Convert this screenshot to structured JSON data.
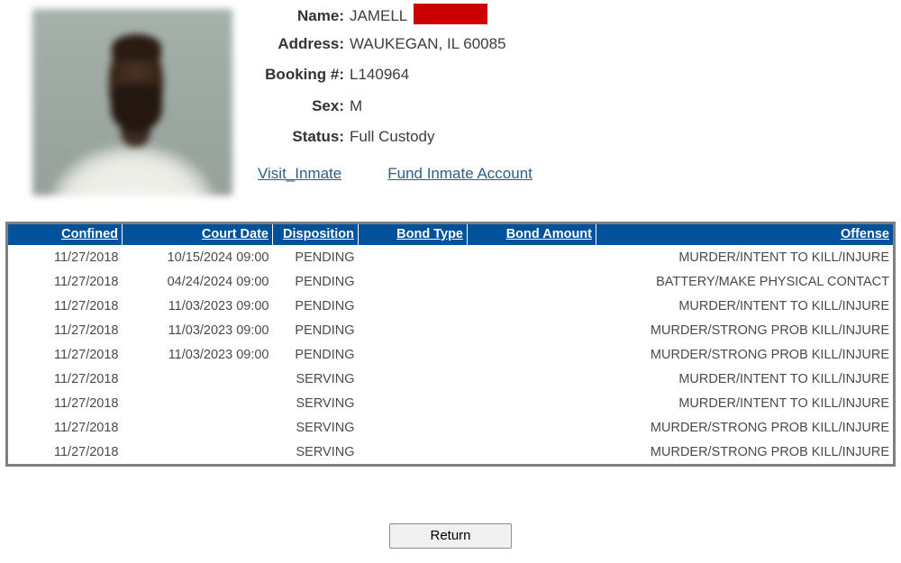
{
  "inmate": {
    "photo_alt": "inmate-mugshot",
    "fields": [
      {
        "label": "Name:",
        "value": "JAMELL",
        "redacted": true
      },
      {
        "label": "Address:",
        "value": "WAUKEGAN, IL 60085",
        "redacted": false
      },
      {
        "label": "Booking #:",
        "value": "L140964",
        "redacted": false
      },
      {
        "label": "Sex:",
        "value": "M",
        "redacted": false
      },
      {
        "label": "Status:",
        "value": "Full Custody",
        "redacted": false
      }
    ],
    "links": [
      {
        "label": "Visit_Inmate"
      },
      {
        "label": "Fund Inmate Account"
      }
    ]
  },
  "charges_table": {
    "columns": [
      "Confined",
      "Court Date",
      "Disposition",
      "Bond Type",
      "Bond Amount",
      "Offense"
    ],
    "rows": [
      {
        "confined": "11/27/2018",
        "court_date": "10/15/2024 09:00",
        "disposition": "PENDING",
        "bond_type": "",
        "bond_amount": "",
        "offense": "MURDER/INTENT TO KILL/INJURE"
      },
      {
        "confined": "11/27/2018",
        "court_date": "04/24/2024 09:00",
        "disposition": "PENDING",
        "bond_type": "",
        "bond_amount": "",
        "offense": "BATTERY/MAKE PHYSICAL CONTACT"
      },
      {
        "confined": "11/27/2018",
        "court_date": "11/03/2023 09:00",
        "disposition": "PENDING",
        "bond_type": "",
        "bond_amount": "",
        "offense": "MURDER/INTENT TO KILL/INJURE"
      },
      {
        "confined": "11/27/2018",
        "court_date": "11/03/2023 09:00",
        "disposition": "PENDING",
        "bond_type": "",
        "bond_amount": "",
        "offense": "MURDER/STRONG PROB KILL/INJURE"
      },
      {
        "confined": "11/27/2018",
        "court_date": "11/03/2023 09:00",
        "disposition": "PENDING",
        "bond_type": "",
        "bond_amount": "",
        "offense": "MURDER/STRONG PROB KILL/INJURE"
      },
      {
        "confined": "11/27/2018",
        "court_date": "",
        "disposition": "SERVING",
        "bond_type": "",
        "bond_amount": "",
        "offense": "MURDER/INTENT TO KILL/INJURE"
      },
      {
        "confined": "11/27/2018",
        "court_date": "",
        "disposition": "SERVING",
        "bond_type": "",
        "bond_amount": "",
        "offense": "MURDER/INTENT TO KILL/INJURE"
      },
      {
        "confined": "11/27/2018",
        "court_date": "",
        "disposition": "SERVING",
        "bond_type": "",
        "bond_amount": "",
        "offense": "MURDER/STRONG PROB KILL/INJURE"
      },
      {
        "confined": "11/27/2018",
        "court_date": "",
        "disposition": "SERVING",
        "bond_type": "",
        "bond_amount": "",
        "offense": "MURDER/STRONG PROB KILL/INJURE"
      }
    ]
  },
  "footer": {
    "return_label": "Return"
  },
  "colors": {
    "header_blue": "#01529c",
    "link_blue": "#2d5f8b",
    "redaction_red": "#cc0000",
    "table_border_gray": "#7f7f7f",
    "body_text": "#4a4a4a"
  }
}
